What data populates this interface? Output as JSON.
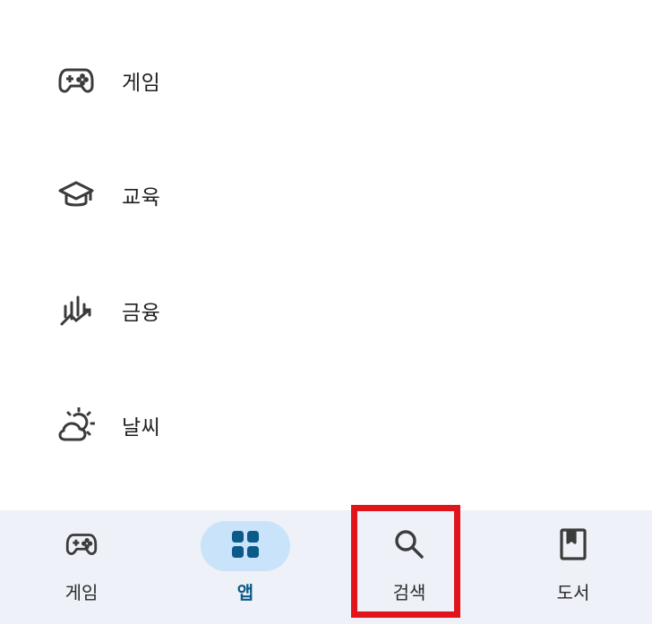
{
  "categories": [
    {
      "label": "게임",
      "icon": "gamepad-icon"
    },
    {
      "label": "교육",
      "icon": "graduation-cap-icon"
    },
    {
      "label": "금융",
      "icon": "finance-chart-icon"
    },
    {
      "label": "날씨",
      "icon": "weather-sun-cloud-icon"
    }
  ],
  "bottom_nav": {
    "items": [
      {
        "label": "게임",
        "icon": "gamepad-icon",
        "active": false
      },
      {
        "label": "앱",
        "icon": "apps-grid-icon",
        "active": true
      },
      {
        "label": "검색",
        "icon": "search-icon",
        "active": false
      },
      {
        "label": "도서",
        "icon": "book-icon",
        "active": false
      }
    ]
  },
  "colors": {
    "nav_background": "#eef1f7",
    "active_pill": "#c8e3fa",
    "active_text": "#0b5a8a",
    "highlight": "#e1141c"
  }
}
